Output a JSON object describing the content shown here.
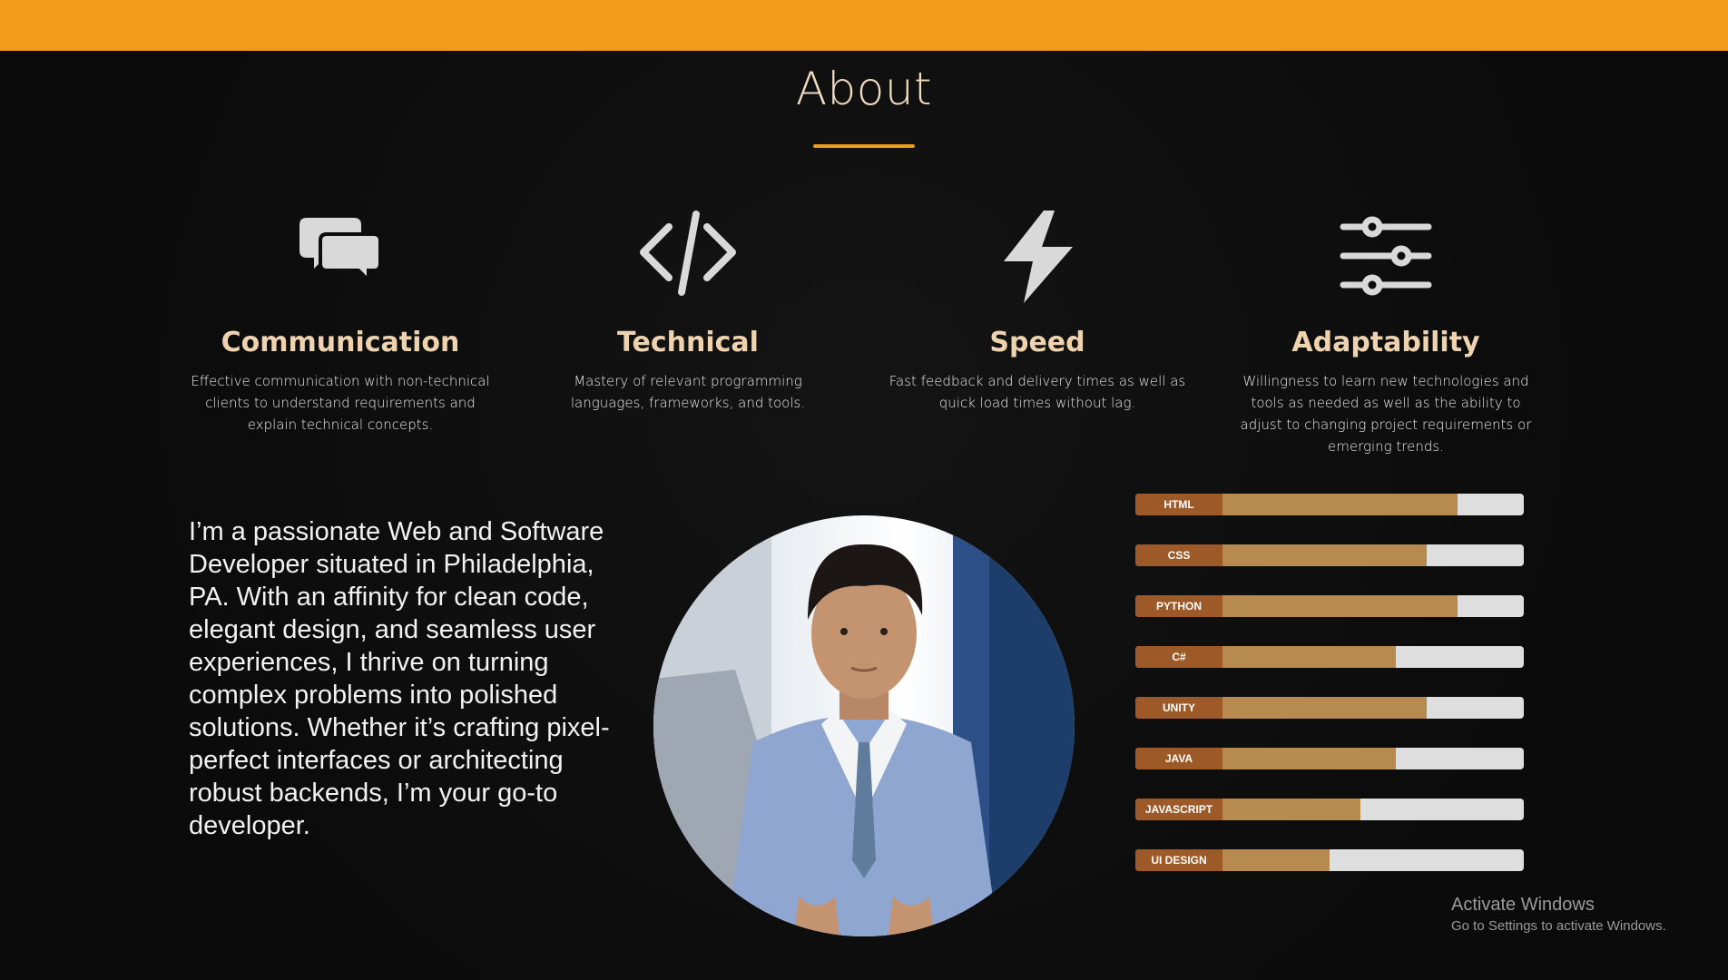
{
  "header": {
    "bar_color": "#f39a1d"
  },
  "about": {
    "title": "About"
  },
  "features": [
    {
      "icon": "chat-bubbles-icon",
      "title": "Communication",
      "description": "Effective communication with non-technical clients to understand requirements and explain technical concepts."
    },
    {
      "icon": "code-icon",
      "title": "Technical",
      "description": "Mastery of relevant programming languages, frameworks, and tools."
    },
    {
      "icon": "lightning-bolt-icon",
      "title": "Speed",
      "description": "Fast feedback and delivery times as well as quick load times without lag."
    },
    {
      "icon": "sliders-icon",
      "title": "Adaptability",
      "description": "Willingness to learn new technologies and tools as needed as well as the ability to adjust to changing project requirements or emerging trends."
    }
  ],
  "intro": {
    "text": "I’m a passionate Web and Software Developer situated in Philadelphia, PA. With an affinity for clean code, elegant design, and seamless user experiences, I thrive on turning complex problems into polished solutions. Whether it’s crafting pixel-perfect interfaces or architecting robust backends, I’m your go-to developer."
  },
  "portrait": {
    "icon": "portrait-photo"
  },
  "skills": [
    {
      "label": "HTML",
      "level": 0.83
    },
    {
      "label": "CSS",
      "level": 0.75
    },
    {
      "label": "PYTHON",
      "level": 0.83
    },
    {
      "label": "C#",
      "level": 0.67
    },
    {
      "label": "UNITY",
      "level": 0.75
    },
    {
      "label": "JAVA",
      "level": 0.67
    },
    {
      "label": "JAVASCRIPT",
      "level": 0.58
    },
    {
      "label": "UI DESIGN",
      "level": 0.5
    }
  ],
  "colors": {
    "accent": "#f39a1d",
    "heading": "#efd3ae",
    "skill_label_bg": "#9d5a28",
    "skill_fill": "#b78a50",
    "skill_track": "#dedede"
  },
  "watermark": {
    "line1": "Activate Windows",
    "line2": "Go to Settings to activate Windows."
  }
}
